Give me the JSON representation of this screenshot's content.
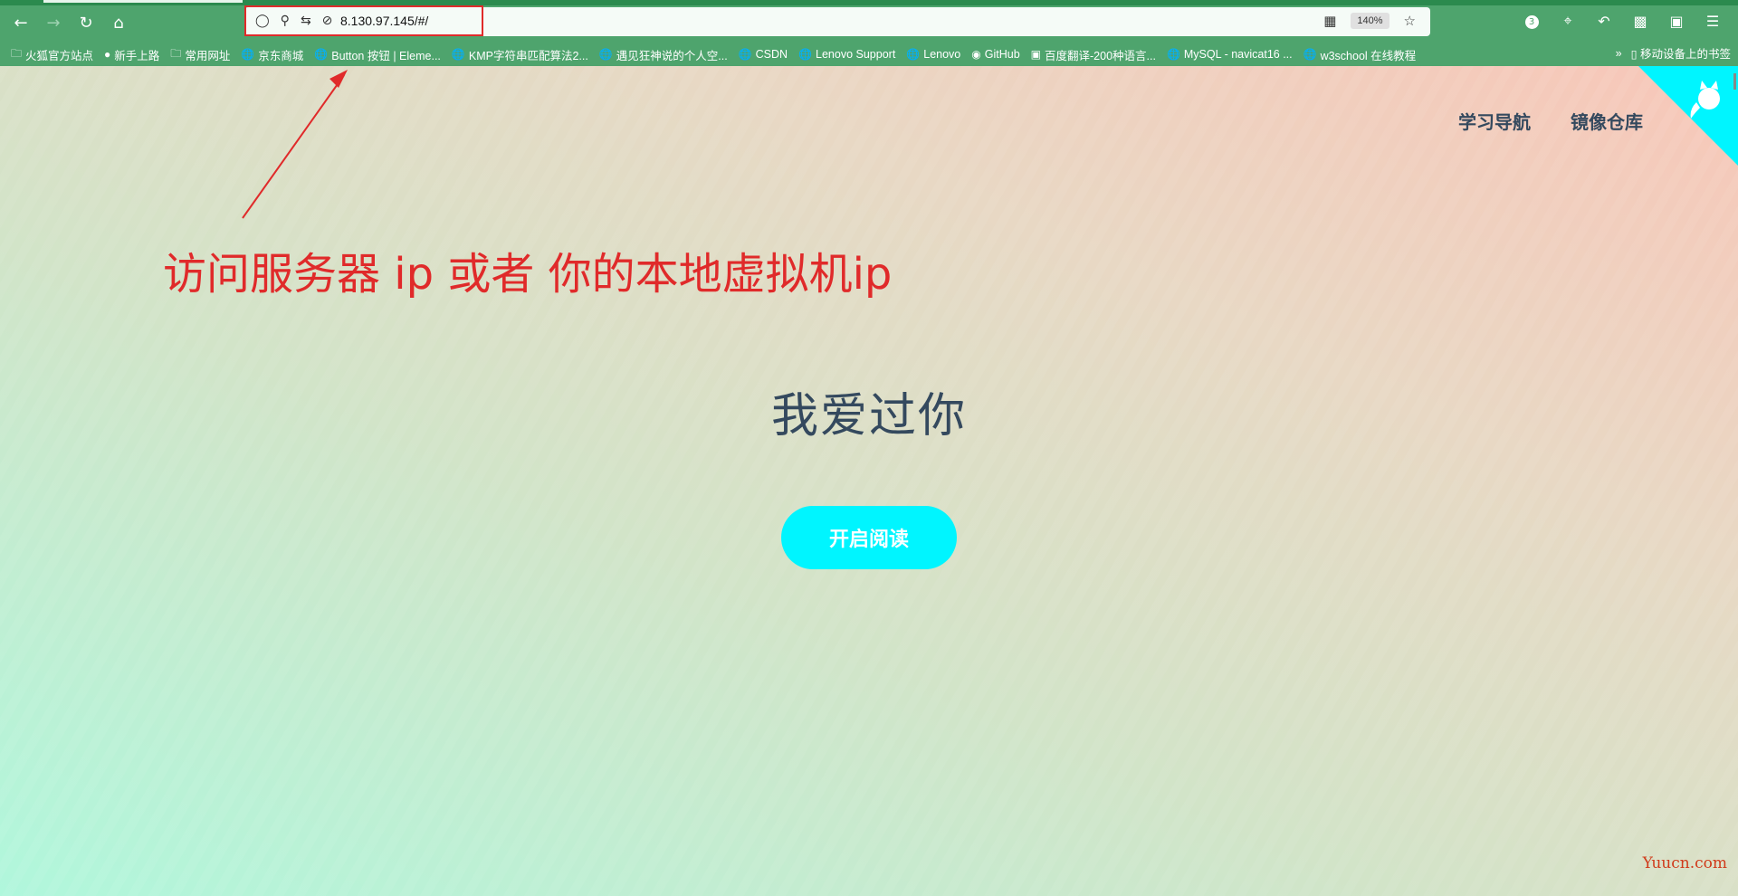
{
  "browser": {
    "url": "8.130.97.145/#/",
    "zoom": "140%",
    "extension_badge": "3",
    "bookmarks": [
      {
        "label": "火狐官方站点",
        "icon": "folder-icon"
      },
      {
        "label": "新手上路",
        "icon": "firefox-icon"
      },
      {
        "label": "常用网址",
        "icon": "folder-icon"
      },
      {
        "label": "京东商城",
        "icon": "globe-icon"
      },
      {
        "label": "Button 按钮 | Eleme...",
        "icon": "globe-icon"
      },
      {
        "label": "KMP字符串匹配算法2...",
        "icon": "globe-icon"
      },
      {
        "label": "遇见狂神说的个人空...",
        "icon": "globe-icon"
      },
      {
        "label": "CSDN",
        "icon": "globe-icon"
      },
      {
        "label": "Lenovo Support",
        "icon": "globe-icon"
      },
      {
        "label": "Lenovo",
        "icon": "globe-icon"
      },
      {
        "label": "GitHub",
        "icon": "github-icon"
      },
      {
        "label": "百度翻译-200种语言...",
        "icon": "translate-icon"
      },
      {
        "label": "MySQL - navicat16 ...",
        "icon": "globe-icon"
      },
      {
        "label": "w3school 在线教程",
        "icon": "globe-icon"
      }
    ],
    "mobile_bookmarks": "移动设备上的书签"
  },
  "page": {
    "nav": [
      "学习导航",
      "镜像仓库"
    ],
    "annotation": "访问服务器 ip 或者 你的本地虚拟机ip",
    "hero_title": "我爱过你",
    "cta_label": "开启阅读",
    "watermark": "Yuucn.com"
  },
  "colors": {
    "chrome": "#4ea46d",
    "accent": "#00f5ff",
    "annotation": "#e02a2a",
    "text": "#34495e"
  }
}
